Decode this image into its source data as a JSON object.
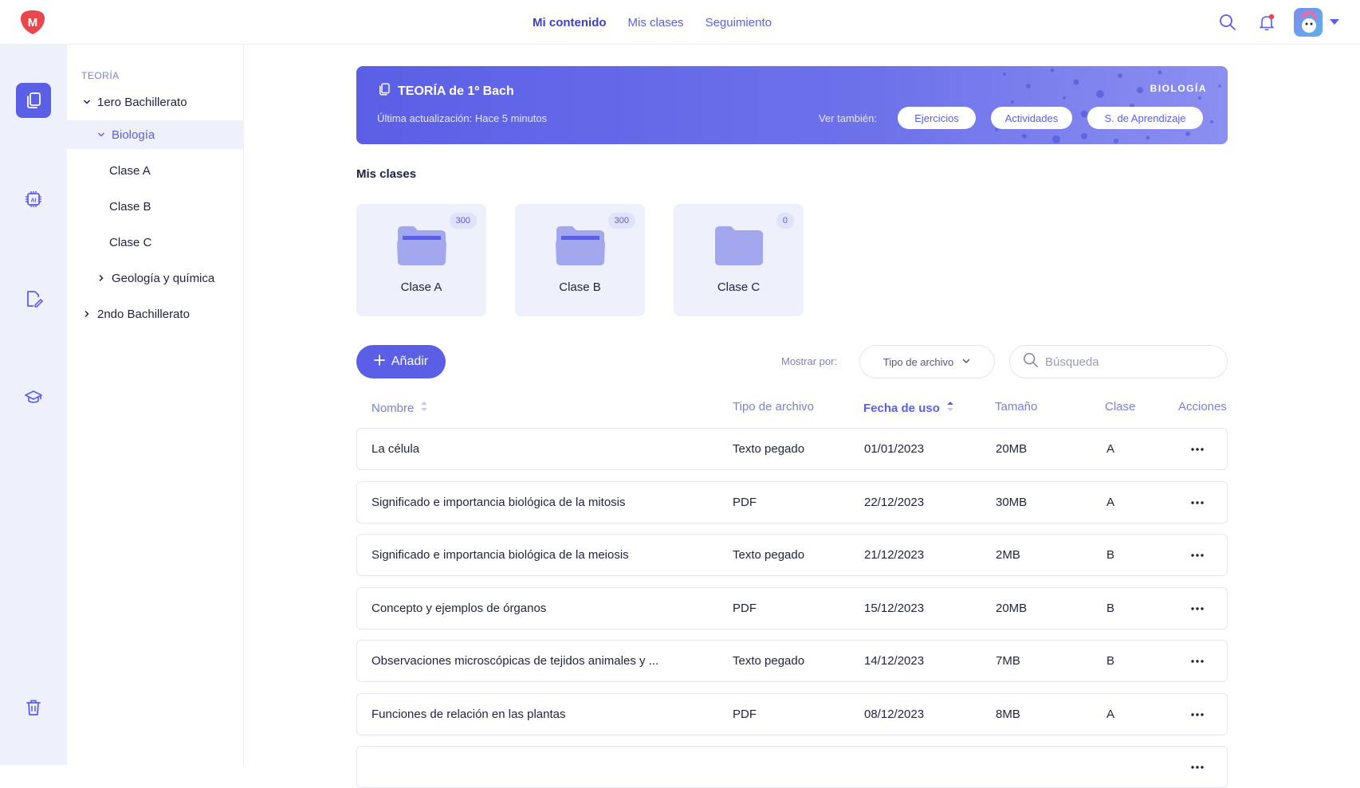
{
  "app": {
    "logo_letter": "M"
  },
  "topnav": [
    {
      "label": "Mi contenido",
      "active": true
    },
    {
      "label": "Mis clases",
      "active": false
    },
    {
      "label": "Seguimiento",
      "active": false
    }
  ],
  "rail": [
    {
      "icon": "documents-icon",
      "active": true
    },
    {
      "icon": "ai-chip-icon",
      "active": false
    },
    {
      "icon": "edit-document-icon",
      "active": false
    },
    {
      "icon": "graduation-cap-icon",
      "active": false
    },
    {
      "icon": "trash-icon",
      "active": false
    }
  ],
  "tree": {
    "title": "TEORÍA",
    "items": [
      {
        "label": "1ero Bachillerato",
        "level": 0,
        "expanded": true,
        "selected": false
      },
      {
        "label": "Biología",
        "level": 1,
        "expanded": true,
        "selected": true
      },
      {
        "label": "Clase A",
        "level": 2,
        "selected": false
      },
      {
        "label": "Clase B",
        "level": 2,
        "selected": false
      },
      {
        "label": "Clase C",
        "level": 2,
        "selected": false
      },
      {
        "label": "Geología y química",
        "level": 1,
        "expanded": false,
        "selected": false
      },
      {
        "label": "2ndo Bachillerato",
        "level": 0,
        "expanded": false,
        "selected": false
      }
    ]
  },
  "banner": {
    "title": "TEORÍA de 1º Bach",
    "subtitle": "Última actualización: Hace 5 minutos",
    "subject": "BIOLOGÍA",
    "see_also_label": "Ver también:",
    "links": [
      "Ejercicios",
      "Actividades",
      "S. de Aprendizaje"
    ],
    "color": "#5b5fe6"
  },
  "classes": {
    "title": "Mis clases",
    "folders": [
      {
        "label": "Clase A",
        "count": "300",
        "has_files": true
      },
      {
        "label": "Clase B",
        "count": "300",
        "has_files": true
      },
      {
        "label": "Clase C",
        "count": "0",
        "has_files": false
      }
    ]
  },
  "toolbar": {
    "add_label": "Añadir",
    "show_by_label": "Mostrar por:",
    "show_by_value": "Tipo de archivo",
    "search_placeholder": "Búsqueda"
  },
  "table": {
    "headers": {
      "name": "Nombre",
      "type": "Tipo de archivo",
      "date": "Fecha de uso",
      "size": "Tamaño",
      "class": "Clase",
      "actions": "Acciones"
    },
    "sorted_by": "date",
    "rows": [
      {
        "name": "La célula",
        "type": "Texto pegado",
        "date": "01/01/2023",
        "size": "20MB",
        "class": "A"
      },
      {
        "name": "Significado e importancia biológica de la mitosis",
        "type": "PDF",
        "date": "22/12/2023",
        "size": "30MB",
        "class": "A"
      },
      {
        "name": "Significado e importancia biológica de la meiosis",
        "type": "Texto pegado",
        "date": "21/12/2023",
        "size": "2MB",
        "class": "B"
      },
      {
        "name": "Concepto y ejemplos de órganos",
        "type": "PDF",
        "date": "15/12/2023",
        "size": "20MB",
        "class": "B"
      },
      {
        "name": "Observaciones microscópicas de tejidos animales y ...",
        "type": "Texto pegado",
        "date": "14/12/2023",
        "size": "7MB",
        "class": "B"
      },
      {
        "name": "Funciones de relación en las plantas",
        "type": "PDF",
        "date": "08/12/2023",
        "size": "8MB",
        "class": "A"
      },
      {
        "name": "",
        "type": "",
        "date": "",
        "size": "",
        "class": ""
      }
    ]
  }
}
